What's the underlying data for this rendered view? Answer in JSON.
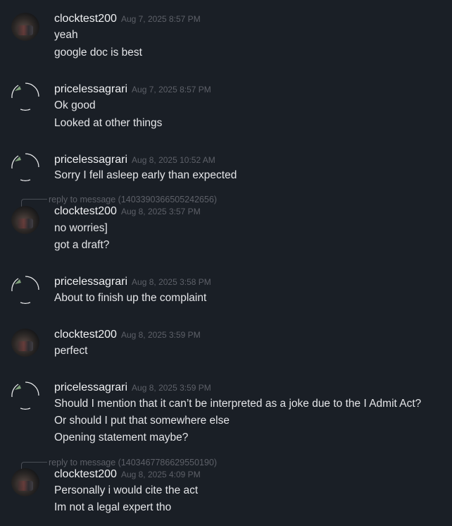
{
  "messages": [
    {
      "user": "clocktest200",
      "avatar": "user1",
      "timestamp": "Aug 7, 2025 8:57 PM",
      "lines": [
        "yeah",
        "google doc is best"
      ]
    },
    {
      "user": "pricelessagrari",
      "avatar": "user2",
      "timestamp": "Aug 7, 2025 8:57 PM",
      "lines": [
        "Ok good",
        "Looked at other things"
      ]
    },
    {
      "user": "pricelessagrari",
      "avatar": "user2",
      "timestamp": "Aug 8, 2025 10:52 AM",
      "lines": [
        "Sorry I fell asleep early than expected"
      ]
    },
    {
      "reply": "reply to message (1403390366505242656)",
      "user": "clocktest200",
      "avatar": "user1",
      "timestamp": "Aug 8, 2025 3:57 PM",
      "lines": [
        "no worries]",
        "got a draft?"
      ]
    },
    {
      "user": "pricelessagrari",
      "avatar": "user2",
      "timestamp": "Aug 8, 2025 3:58 PM",
      "lines": [
        "About to finish up the complaint"
      ]
    },
    {
      "user": "clocktest200",
      "avatar": "user1",
      "timestamp": "Aug 8, 2025 3:59 PM",
      "lines": [
        "perfect"
      ]
    },
    {
      "user": "pricelessagrari",
      "avatar": "user2",
      "timestamp": "Aug 8, 2025 3:59 PM",
      "lines": [
        "Should I mention that it can’t be interpreted as a joke due to the I Admit Act?",
        "Or should I put that somewhere else",
        "Opening statement maybe?"
      ]
    },
    {
      "reply": "reply to message (1403467786629550190)",
      "user": "clocktest200",
      "avatar": "user1",
      "timestamp": "Aug 8, 2025 4:09 PM",
      "lines": [
        "Personally i would cite the act",
        "Im not a legal expert tho"
      ]
    }
  ]
}
